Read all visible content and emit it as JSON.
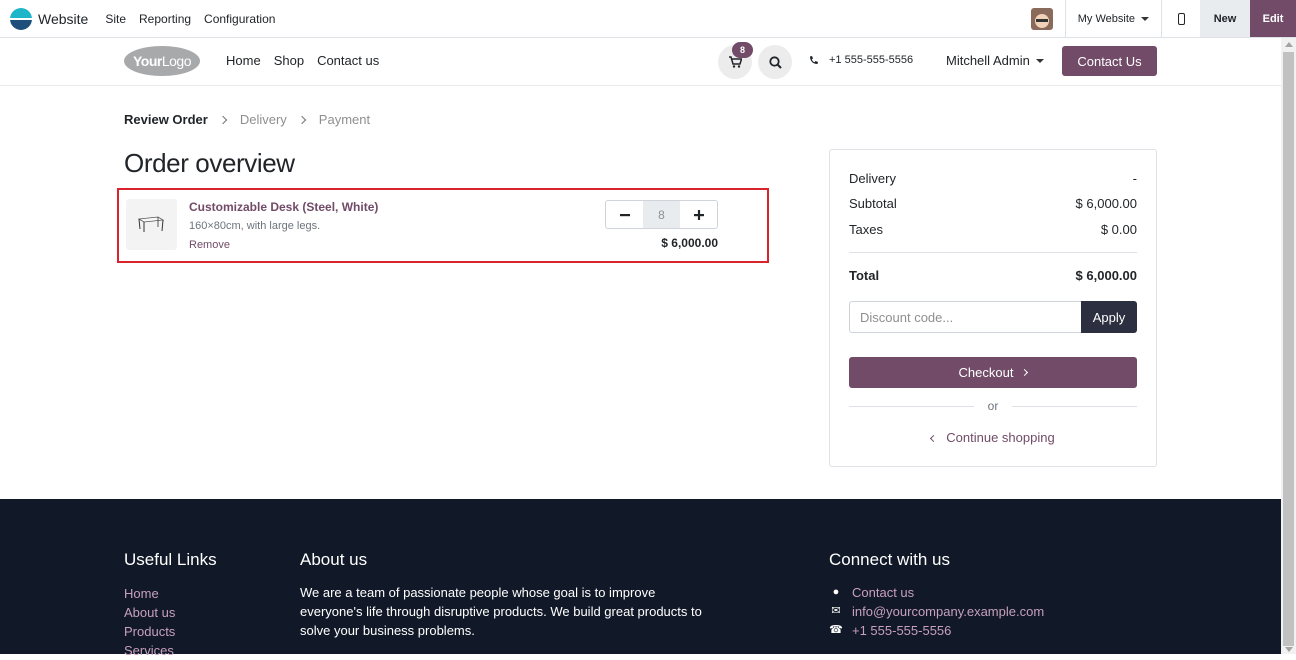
{
  "topbar": {
    "app_name": "Website",
    "menu": [
      "Site",
      "Reporting",
      "Configuration"
    ],
    "website_selector": "My Website",
    "new_label": "New",
    "edit_label": "Edit"
  },
  "header": {
    "logo_text_bold": "Your",
    "logo_text_thin": "Logo",
    "nav": [
      "Home",
      "Shop",
      "Contact us"
    ],
    "cart_count": "8",
    "phone": "+1 555-555-5556",
    "user": "Mitchell Admin",
    "contact_button": "Contact Us"
  },
  "steps": {
    "review": "Review Order",
    "delivery": "Delivery",
    "payment": "Payment"
  },
  "page_title": "Order overview",
  "order_line": {
    "product_name": "Customizable Desk (Steel, White)",
    "description": "160×80cm, with large legs.",
    "remove": "Remove",
    "quantity": "8",
    "price": "$ 6,000.00"
  },
  "summary": {
    "delivery_label": "Delivery",
    "delivery_value": "-",
    "subtotal_label": "Subtotal",
    "subtotal_value": "$ 6,000.00",
    "taxes_label": "Taxes",
    "taxes_value": "$ 0.00",
    "total_label": "Total",
    "total_value": "$ 6,000.00",
    "discount_placeholder": "Discount code...",
    "apply_label": "Apply",
    "checkout_label": "Checkout",
    "or_label": "or",
    "continue_label": "Continue shopping"
  },
  "footer": {
    "useful_links_title": "Useful Links",
    "useful_links": [
      "Home",
      "About us",
      "Products",
      "Services"
    ],
    "about_title": "About us",
    "about_text": "We are a team of passionate people whose goal is to improve everyone's life through disruptive products. We build great products to solve your business problems.",
    "connect_title": "Connect with us",
    "connect_contact": "Contact us",
    "connect_email": "info@yourcompany.example.com",
    "connect_phone": "+1 555-555-5556"
  },
  "colors": {
    "brand": "#714b67",
    "highlight_border": "#d9242d",
    "footer_bg": "#111827"
  }
}
